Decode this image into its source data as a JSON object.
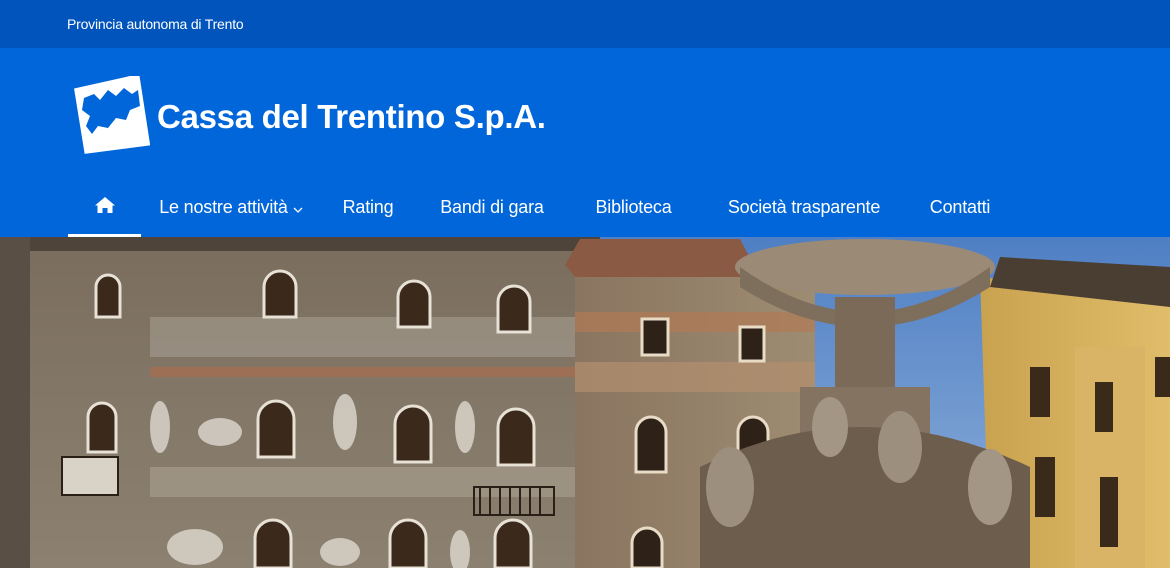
{
  "topbar": {
    "region_link": "Provincia autonoma di Trento"
  },
  "header": {
    "brand_name": "Cassa del Trentino S.p.A.",
    "logo_icon": "trentino-map-logo"
  },
  "nav": {
    "home_icon": "home-icon",
    "items": [
      {
        "label": "Le nostre attività",
        "has_dropdown": true
      },
      {
        "label": "Rating"
      },
      {
        "label": "Bandi di gara"
      },
      {
        "label": "Biblioteca"
      },
      {
        "label": "Società trasparente"
      },
      {
        "label": "Contatti"
      }
    ]
  },
  "colors": {
    "topbar": "#0054bc",
    "header": "#0066d9",
    "text": "#ffffff"
  },
  "hero": {
    "image": "Trento Piazza Duomo frescoed houses and Neptune fountain"
  }
}
